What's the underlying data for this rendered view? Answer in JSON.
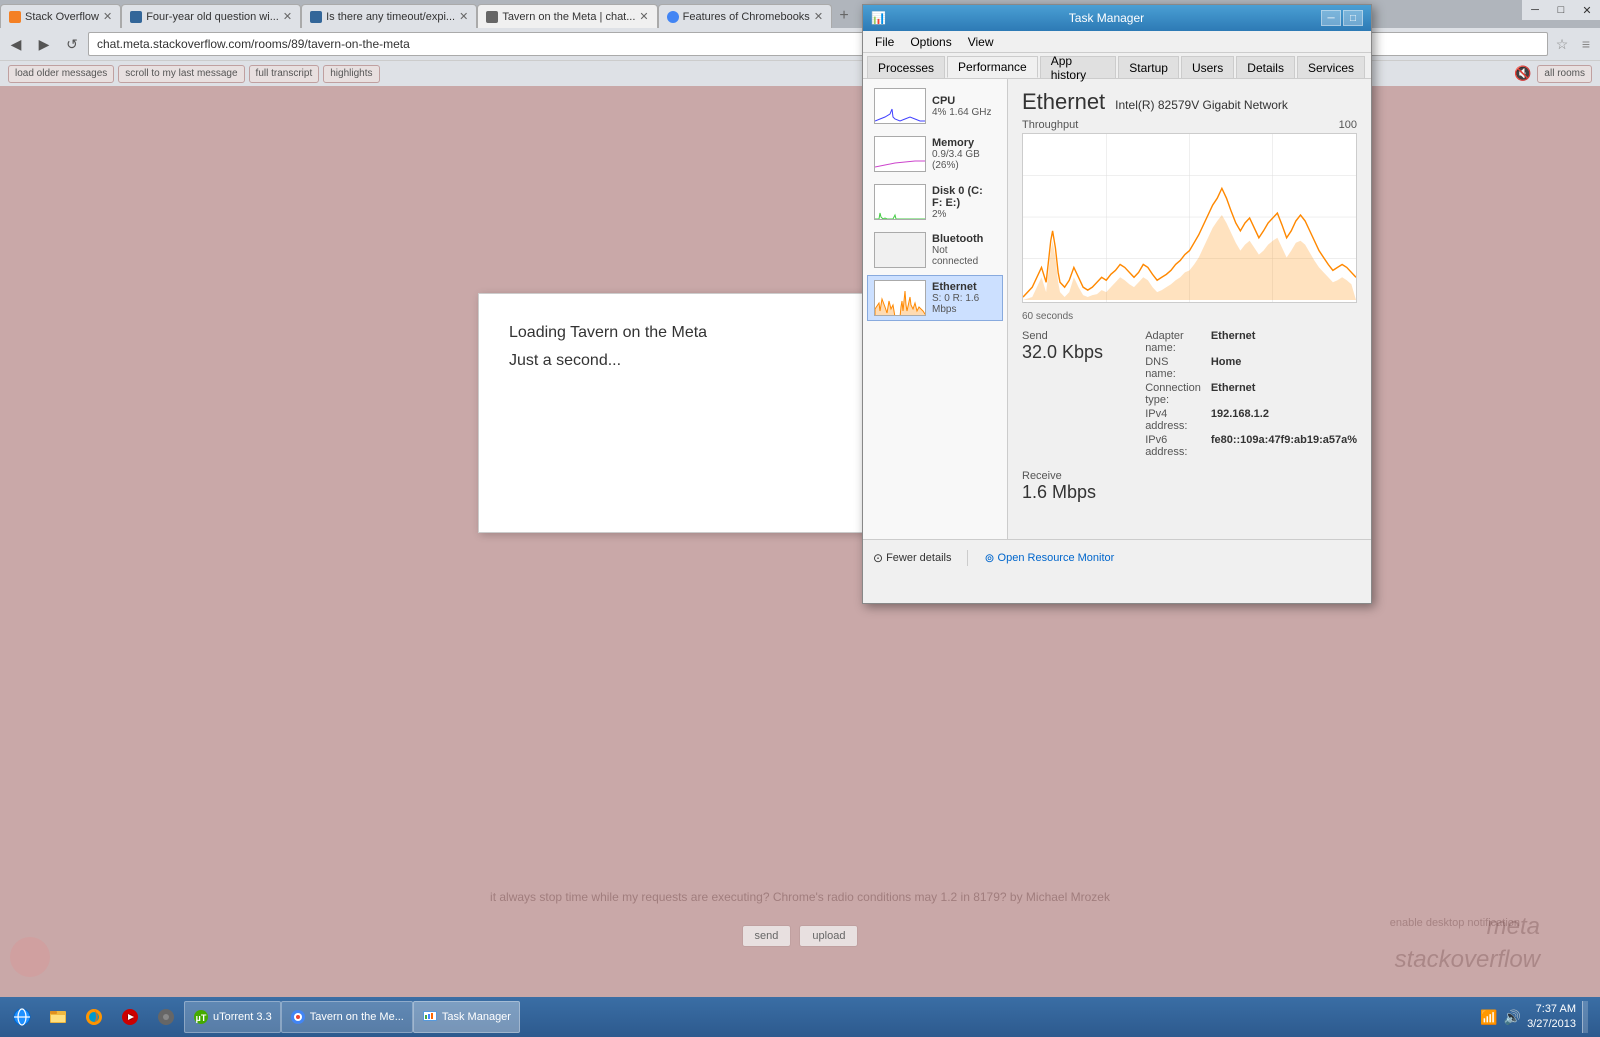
{
  "browser": {
    "tabs": [
      {
        "id": 1,
        "title": "Stack Overflow",
        "url": "",
        "active": false,
        "favicon": "so"
      },
      {
        "id": 2,
        "title": "Four-year old question wi...",
        "url": "",
        "active": false,
        "favicon": "q"
      },
      {
        "id": 3,
        "title": "Is there any timeout/expi...",
        "url": "",
        "active": false,
        "favicon": "q"
      },
      {
        "id": 4,
        "title": "Tavern on the Meta | chat...",
        "url": "",
        "active": true,
        "favicon": "meta"
      },
      {
        "id": 5,
        "title": "Features of Chromebooks",
        "url": "",
        "active": false,
        "favicon": "chrome"
      }
    ],
    "address": "chat.meta.stackoverflow.com/rooms/89/tavern-on-the-meta",
    "toolbar_buttons": [
      {
        "label": "load older messages"
      },
      {
        "label": "scroll to my last message"
      },
      {
        "label": "full transcript"
      },
      {
        "label": "highlights"
      }
    ],
    "toolbar_right": "all rooms"
  },
  "loading_dialog": {
    "title": "Loading Tavern on the Meta",
    "subtitle": "Just a second..."
  },
  "bg_text": "it always stop time while my requests are executing? Chrome's radio conditions may 1.2 in 8179? by Michael Mrozek",
  "bg_text2": "enable desktop notification",
  "watermark": "meta\nstackoverflow",
  "chat_buttons": [
    "send",
    "upload"
  ],
  "taskbar": {
    "apps": [
      {
        "label": "",
        "icon": "ie",
        "active": false
      },
      {
        "label": "",
        "icon": "explorer",
        "active": false
      },
      {
        "label": "",
        "icon": "firefox",
        "active": false
      },
      {
        "label": "",
        "icon": "media",
        "active": false
      },
      {
        "label": "",
        "icon": "misc",
        "active": false
      },
      {
        "label": "uTorrent 3.3",
        "icon": "utorrent",
        "active": false
      },
      {
        "label": "Tavern on the Me...",
        "icon": "chrome",
        "active": false
      },
      {
        "label": "Task Manager",
        "icon": "taskmgr",
        "active": true
      }
    ],
    "time": "7:37 AM",
    "date": "3/27/2013"
  },
  "task_manager": {
    "title": "Task Manager",
    "menus": [
      "File",
      "Options",
      "View"
    ],
    "tabs": [
      "Processes",
      "Performance",
      "App history",
      "Startup",
      "Users",
      "Details",
      "Services"
    ],
    "active_tab": "Performance",
    "perf_items": [
      {
        "name": "CPU",
        "value": "4% 1.64 GHz",
        "type": "cpu"
      },
      {
        "name": "Memory",
        "value": "0.9/3.4 GB (26%)",
        "type": "memory"
      },
      {
        "name": "Disk 0 (C: F: E:)",
        "value": "2%",
        "type": "disk"
      },
      {
        "name": "Bluetooth",
        "value": "Not connected",
        "type": "bluetooth"
      },
      {
        "name": "Ethernet",
        "value": "S: 0 R: 1.6 Mbps",
        "type": "ethernet",
        "selected": true
      }
    ],
    "ethernet": {
      "title": "Ethernet",
      "adapter": "Intel(R) 82579V Gigabit Network",
      "throughput_label": "Throughput",
      "throughput_max": "100",
      "chart_seconds": "60 seconds",
      "send_label": "Send",
      "send_value": "32.0 Kbps",
      "receive_label": "Receive",
      "receive_value": "1.6 Mbps",
      "adapter_name_label": "Adapter name:",
      "adapter_name_value": "Ethernet",
      "dns_name_label": "DNS name:",
      "dns_name_value": "Home",
      "connection_type_label": "Connection type:",
      "connection_type_value": "Ethernet",
      "ipv4_label": "IPv4 address:",
      "ipv4_value": "192.168.1.2",
      "ipv6_label": "IPv6 address:",
      "ipv6_value": "fe80::109a:47f9:ab19:a57a%"
    },
    "footer": {
      "fewer_details": "Fewer details",
      "open_rm": "Open Resource Monitor"
    }
  }
}
